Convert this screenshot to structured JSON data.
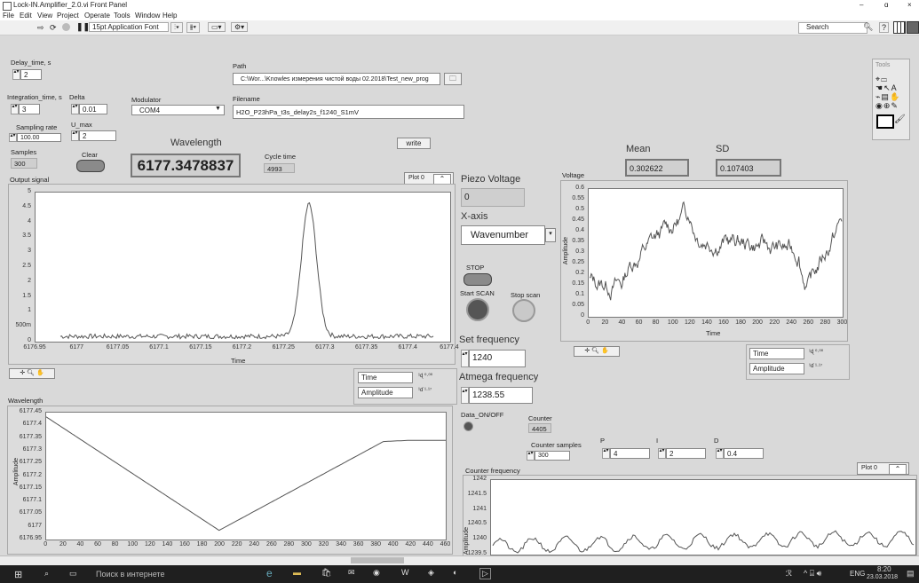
{
  "window": {
    "title": "Lock-IN.Amplifier_2.0.vi Front Panel",
    "controls": [
      "–",
      "ɑ",
      "×"
    ]
  },
  "menu": [
    "File",
    "Edit",
    "View",
    "Project",
    "Operate",
    "Tools",
    "Window",
    "Help"
  ],
  "toolbar": {
    "font": "15pt Application Font",
    "search_placeholder": "Search"
  },
  "left": {
    "delay_label": "Delay_time, s",
    "delay_value": "2",
    "integration_label": "Integration_time, s",
    "integration_value": "3",
    "delta_label": "Delta",
    "delta_value": "0.01",
    "modulator_label": "Modulator",
    "modulator_value": "COM4",
    "umax_label": "U_max",
    "umax_value": "2",
    "sampling_label": "Sampling rate",
    "sampling_value": "100.00",
    "samples_label": "Samples",
    "samples_value": "300",
    "clear_label": "Clear"
  },
  "path": {
    "label": "Path",
    "value": "C:\\Wor...\\Knowles измерения чистой воды 02.2018\\Test_new_prog"
  },
  "filename": {
    "label": "Filename",
    "value": "H2O_P23hPa_t3s_delay2s_f1240_S1mV"
  },
  "wavelength": {
    "label": "Wavelength",
    "value": "6177.3478837"
  },
  "cycle": {
    "label": "Cycle time",
    "value": "4993"
  },
  "write_label": "write",
  "plot0": "Plot 0",
  "output_graph": {
    "title": "Output signal",
    "xlabel": "Time",
    "yticks": [
      "5",
      "4.5",
      "4",
      "3.5",
      "3",
      "2.5",
      "2",
      "1.5",
      "1",
      "500m",
      "0"
    ],
    "xticks": [
      "6176.95",
      "6177",
      "6177.05",
      "6177.1",
      "6177.15",
      "6177.2",
      "6177.25",
      "6177.3",
      "6177.35",
      "6177.4",
      "6177.4"
    ]
  },
  "legend": {
    "time": "Time",
    "amplitude": "Amplitude",
    "fmt1": "¹ɖ ⁰·⁰⁰",
    "fmt2": "¹ɗ ¹·¹⁷"
  },
  "piezo": {
    "label": "Piezo Voltage",
    "value": "0"
  },
  "xaxis": {
    "label": "X-axis",
    "value": "Wavenumber"
  },
  "stop_label": "STOP",
  "start_scan": "Start SCAN",
  "stop_scan": "Stop scan",
  "set_freq": {
    "label": "Set frequency",
    "value": "1240"
  },
  "atmega": {
    "label": "Atmega frequency",
    "value": "1238.55"
  },
  "data_onoff": "Data_ON/OFF",
  "counter": {
    "label": "Counter",
    "value": "4405"
  },
  "counter_samples": {
    "label": "Counter samples",
    "value": "300"
  },
  "pid": {
    "p_label": "P",
    "p": "4",
    "i_label": "I",
    "i": "2",
    "d_label": "D",
    "d": "0.4"
  },
  "mean": {
    "label": "Mean",
    "value": "0.302622"
  },
  "sd": {
    "label": "SD",
    "value": "0.107403"
  },
  "voltage_graph": {
    "title": "Voltage",
    "ylabel": "Amplitude",
    "xlabel": "Time",
    "yticks": [
      "0.6",
      "0.55",
      "0.5",
      "0.45",
      "0.4",
      "0.35",
      "0.3",
      "0.25",
      "0.2",
      "0.15",
      "0.1",
      "0.05",
      "0"
    ],
    "xticks": [
      "0",
      "20",
      "40",
      "60",
      "80",
      "100",
      "120",
      "140",
      "160",
      "180",
      "200",
      "220",
      "240",
      "260",
      "280",
      "300"
    ]
  },
  "wavelength_graph": {
    "title": "Wavelength",
    "ylabel": "Amplitude",
    "yticks": [
      "6177.45",
      "6177.4",
      "6177.35",
      "6177.3",
      "6177.25",
      "6177.2",
      "6177.15",
      "6177.1",
      "6177.05",
      "6177",
      "6176.95"
    ],
    "xticks": [
      "0",
      "20",
      "40",
      "60",
      "80",
      "100",
      "120",
      "140",
      "160",
      "180",
      "200",
      "220",
      "240",
      "260",
      "280",
      "300",
      "320",
      "340",
      "360",
      "380",
      "400",
      "420",
      "440",
      "460"
    ]
  },
  "counter_graph": {
    "title": "Counter frequency",
    "ylabel": "Amplitude",
    "yticks": [
      "1242",
      "1241.5",
      "1241",
      "1240.5",
      "1240",
      "1239.5"
    ]
  },
  "tools": {
    "title": "Tools"
  },
  "taskbar": {
    "search": "Поиск в интернете",
    "lang": "ENG",
    "time": "8:20",
    "date": "23.03.2018"
  },
  "colors": {
    "plot_line": "#555555",
    "panel": "#d9d9d9",
    "taskbar": "#1f1f1f"
  }
}
